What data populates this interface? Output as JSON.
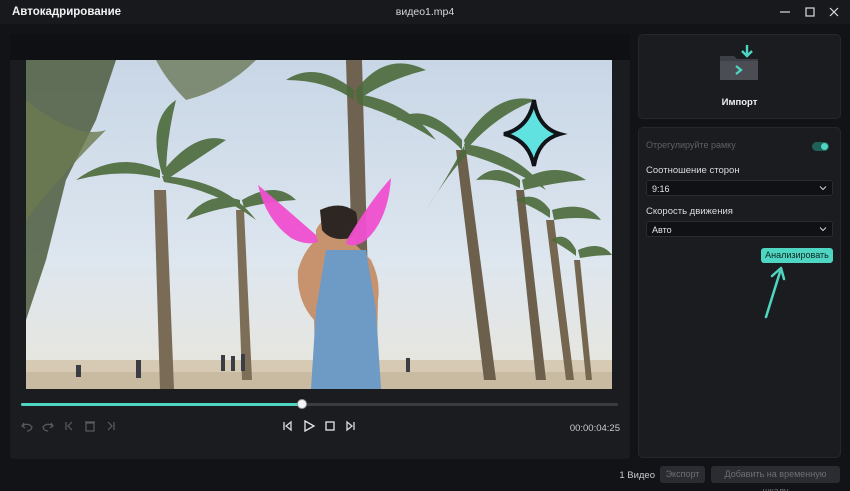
{
  "window": {
    "app_title": "Автокадрирование",
    "file_name": "видео1.mp4"
  },
  "player": {
    "timecode": "00:00:04:25",
    "progress_fraction": 0.47
  },
  "import": {
    "label": "Импорт"
  },
  "settings": {
    "frame_toggle_label": "Отрегулируйте рамку",
    "frame_toggle_on": true,
    "aspect_label": "Соотношение сторон",
    "aspect_value": "9:16",
    "speed_label": "Скорость движения",
    "speed_value": "Авто",
    "analyze_label": "Анализировать"
  },
  "footer": {
    "video_count": "1 Видео",
    "export_label": "Экспорт",
    "add_timeline_label": "Добавить на временную шкалу"
  },
  "colors": {
    "accent": "#4fd6c2",
    "background": "#121316",
    "panel": "#1b1c20"
  },
  "icons": [
    "minimize-icon",
    "maximize-icon",
    "close-icon",
    "undo-icon",
    "redo-icon",
    "trim-start-icon",
    "delete-icon",
    "trim-end-icon",
    "prev-frame-icon",
    "play-icon",
    "stop-icon",
    "next-frame-icon",
    "import-folder-icon",
    "chevron-down-icon",
    "arrow-pointer-icon"
  ]
}
